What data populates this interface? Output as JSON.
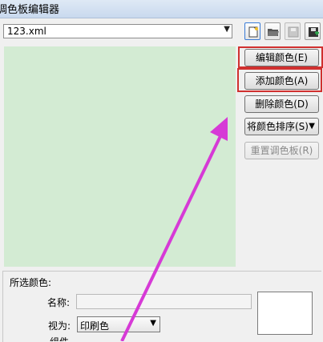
{
  "window": {
    "title": "调色板编辑器"
  },
  "file": {
    "selected": "123.xml"
  },
  "toolbar": {
    "icons": [
      "new-file-icon",
      "open-folder-icon",
      "save-icon",
      "save-as-icon"
    ]
  },
  "actions": {
    "edit_color": "编辑颜色(E)",
    "add_color": "添加颜色(A)",
    "delete_color": "删除颜色(D)",
    "sort_colors": "将颜色排序(S)",
    "reset_palette": "重置调色板(R)"
  },
  "selected_color": {
    "section_label": "所选颜色:",
    "name_label": "名称:",
    "name_value": "",
    "view_label": "视为:",
    "view_value": "印刷色",
    "cut_label": "组件"
  },
  "colors": {
    "swatch_area": "#d3ebd3",
    "highlight": "#d0302f",
    "arrow": "#d63ad6"
  }
}
